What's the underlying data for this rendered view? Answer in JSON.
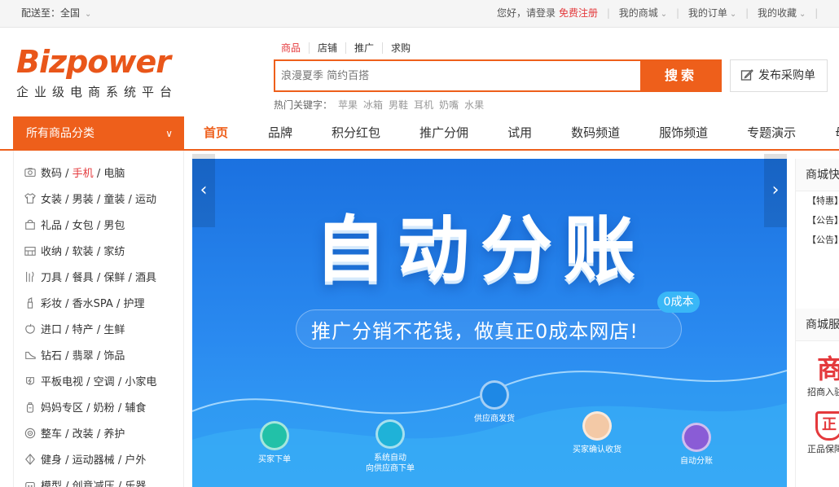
{
  "topbar": {
    "ship_to": "配送至：全国",
    "greeting": "您好，请登录",
    "register": "免费注册",
    "links": [
      "我的商城",
      "我的订单",
      "我的收藏"
    ]
  },
  "logo": {
    "brand": "Bizpower",
    "tagline": "企业级电商系统平台"
  },
  "search": {
    "tabs": [
      "商品",
      "店铺",
      "推广",
      "求购"
    ],
    "placeholder": "浪漫夏季 简约百搭",
    "button": "搜索",
    "purchase_button": "发布采购单",
    "hot_label": "热门关键字：",
    "hot_keywords": [
      "苹果",
      "冰箱",
      "男鞋",
      "耳机",
      "奶嘴",
      "水果"
    ]
  },
  "nav": {
    "all_categories": "所有商品分类",
    "items": [
      "首页",
      "品牌",
      "积分红包",
      "推广分佣",
      "试用",
      "数码频道",
      "服饰频道",
      "专题演示",
      "母"
    ]
  },
  "categories": [
    {
      "icon": "camera-icon",
      "parts": [
        "数码",
        "手机",
        "电脑"
      ],
      "highlight": 1
    },
    {
      "icon": "shirt-icon",
      "parts": [
        "女装",
        "男装",
        "童装",
        "运动"
      ],
      "highlight": -1
    },
    {
      "icon": "gift-bag-icon",
      "parts": [
        "礼品",
        "女包",
        "男包"
      ],
      "highlight": -1
    },
    {
      "icon": "storage-icon",
      "parts": [
        "收纳",
        "软装",
        "家纺"
      ],
      "highlight": -1
    },
    {
      "icon": "utensils-icon",
      "parts": [
        "刀具",
        "餐具",
        "保鲜",
        "酒具"
      ],
      "highlight": -1
    },
    {
      "icon": "lipstick-icon",
      "parts": [
        "彩妆",
        "香水SPA",
        "护理"
      ],
      "highlight": -1
    },
    {
      "icon": "apple-icon",
      "parts": [
        "进口",
        "特产",
        "生鲜"
      ],
      "highlight": -1
    },
    {
      "icon": "shoe-icon",
      "parts": [
        "钻石",
        "翡翠",
        "饰品"
      ],
      "highlight": -1
    },
    {
      "icon": "plug-icon",
      "parts": [
        "平板电视",
        "空调",
        "小家电"
      ],
      "highlight": -1
    },
    {
      "icon": "baby-bottle-icon",
      "parts": [
        "妈妈专区",
        "奶粉",
        "辅食"
      ],
      "highlight": -1
    },
    {
      "icon": "tire-icon",
      "parts": [
        "整车",
        "改装",
        "养护"
      ],
      "highlight": -1
    },
    {
      "icon": "fitness-icon",
      "parts": [
        "健身",
        "运动器械",
        "户外"
      ],
      "highlight": -1
    },
    {
      "icon": "toy-icon",
      "parts": [
        "模型",
        "创意减压",
        "乐器"
      ],
      "highlight": -1
    }
  ],
  "banner": {
    "title": "自动分账",
    "badge": "0成本",
    "slogan": "推广分销不花钱，做真正0成本网店!",
    "steps": [
      {
        "label": "买家下单",
        "icon": "basket-icon",
        "color": "#22c1a8"
      },
      {
        "label": "系统自动\n向供应商下单",
        "icon": "document-icon",
        "color": "#1fb2d8"
      },
      {
        "label": "供应商发货",
        "icon": "truck-icon",
        "color": "#1e88e5"
      },
      {
        "label": "买家确认收货",
        "icon": "check-box-icon",
        "color": "#f3c9a6"
      },
      {
        "label": "自动分账",
        "icon": "split-icon",
        "color": "#8a5cd6"
      }
    ],
    "prev": "‹",
    "next": "›"
  },
  "right_panel": {
    "news_title": "商城快",
    "news": [
      "【特惠】",
      "【公告】",
      "【公告】"
    ],
    "service_title": "商城服",
    "service_1_glyph": "商",
    "service_1": "招商入驻",
    "service_2_glyph": "正",
    "service_2": "正品保障"
  },
  "colors": {
    "accent": "#ee5f1b",
    "link_red": "#e4393c",
    "brand_blue": "#1f58b6"
  }
}
